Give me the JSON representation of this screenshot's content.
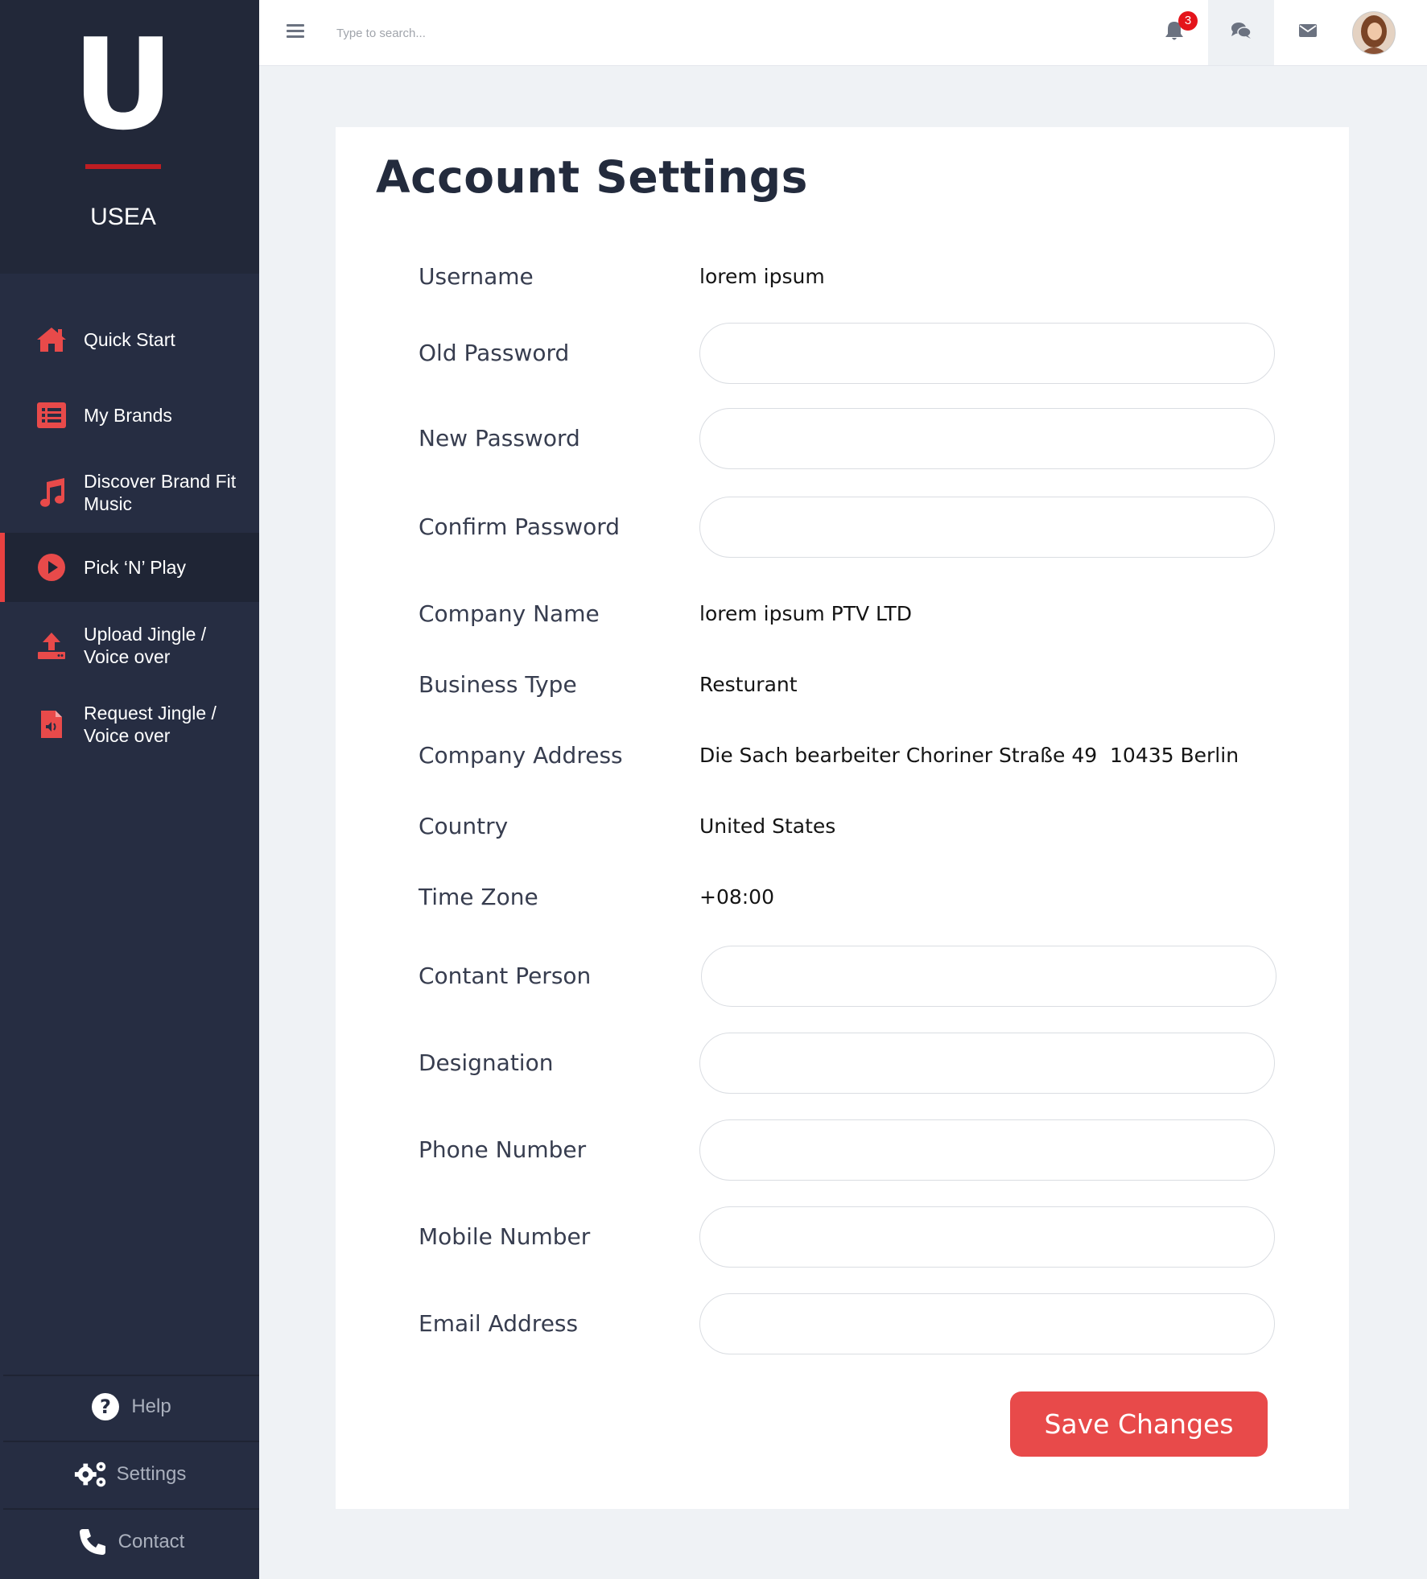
{
  "brand": {
    "letter": "U",
    "name": "USEA"
  },
  "sidebar": {
    "items": [
      {
        "label": "Quick Start",
        "icon": "home-icon"
      },
      {
        "label": "My Brands",
        "icon": "list-icon"
      },
      {
        "label": "Discover Brand Fit Music",
        "icon": "music-note-icon"
      },
      {
        "label": "Pick ‘N’ Play",
        "icon": "play-circle-icon",
        "active": true
      },
      {
        "label": "Upload Jingle / Voice over",
        "icon": "upload-icon"
      },
      {
        "label": "Request Jingle / Voice over",
        "icon": "audio-file-icon"
      }
    ],
    "footer": [
      {
        "label": "Help",
        "icon": "question-circle-icon"
      },
      {
        "label": "Settings",
        "icon": "gears-icon"
      },
      {
        "label": "Contact",
        "icon": "phone-icon"
      }
    ]
  },
  "topbar": {
    "search_placeholder": "Type to search...",
    "notification_count": "3"
  },
  "page": {
    "title": "Account Settings",
    "fields": {
      "username": {
        "label": "Username",
        "value": "lorem ipsum"
      },
      "old_password": {
        "label": "Old Password",
        "value": ""
      },
      "new_password": {
        "label": "New Password",
        "value": ""
      },
      "confirm_password": {
        "label": "Confirm Password",
        "value": ""
      },
      "company_name": {
        "label": "Company Name",
        "value": "lorem ipsum PTV LTD"
      },
      "business_type": {
        "label": "Business Type",
        "value": "Resturant"
      },
      "company_address": {
        "label": "Company Address",
        "value": "Die Sach bearbeiter Choriner Straße 49  10435 Berlin"
      },
      "country": {
        "label": "Country",
        "value": "United States"
      },
      "time_zone": {
        "label": "Time Zone",
        "value": "+08:00"
      },
      "contact_person": {
        "label": "Contant Person",
        "value": ""
      },
      "designation": {
        "label": "Designation",
        "value": ""
      },
      "phone_number": {
        "label": "Phone Number",
        "value": ""
      },
      "mobile_number": {
        "label": "Mobile Number",
        "value": ""
      },
      "email_address": {
        "label": "Email Address",
        "value": ""
      }
    },
    "save_label": "Save Changes"
  },
  "colors": {
    "sidebar_bg": "#262d42",
    "accent": "#e84a4a",
    "brand_bar": "#bf1d22",
    "page_bg": "#eff2f5"
  }
}
